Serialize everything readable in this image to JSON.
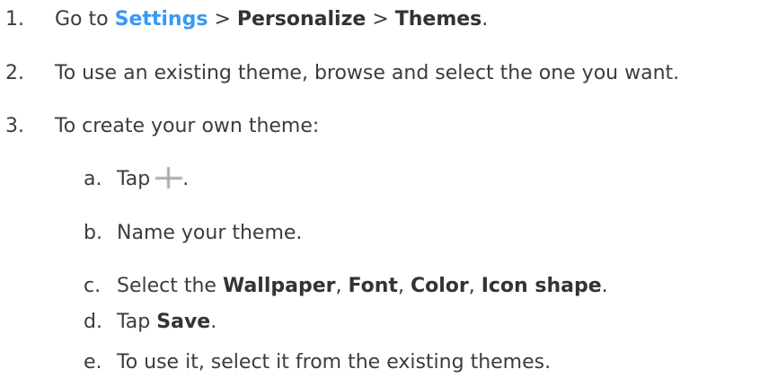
{
  "steps": [
    {
      "number": "1.",
      "prefix": "Go to",
      "settings_link": "Settings",
      "sep1": ">",
      "personalize": "Personalize",
      "sep2": ">",
      "themes": "Themes",
      "suffix": "."
    },
    {
      "number": "2.",
      "text": "To use an existing theme, browse and select the one you want."
    },
    {
      "number": "3.",
      "text": "To create your own theme:"
    }
  ],
  "substeps": [
    {
      "letter": "a.",
      "prefix": "Tap",
      "icon": "plus-icon",
      "suffix": "."
    },
    {
      "letter": "b.",
      "text": "Name your theme."
    },
    {
      "letter": "c.",
      "prefix": "Select the",
      "wallpaper": "Wallpaper",
      "comma1": ",",
      "font": "Font",
      "comma2": ",",
      "color": "Color",
      "comma3": ",",
      "icon_shape": "Icon shape",
      "suffix": "."
    },
    {
      "letter": "d.",
      "prefix": "Tap",
      "save": "Save",
      "suffix": "."
    },
    {
      "letter": "e.",
      "text": "To use it, select it from the existing themes."
    }
  ]
}
